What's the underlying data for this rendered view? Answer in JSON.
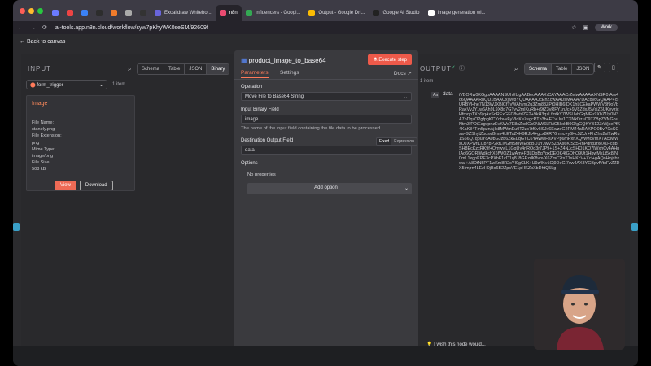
{
  "browser": {
    "tabs": [
      {
        "label": "",
        "color": "#6b7bff"
      },
      {
        "label": "",
        "color": "#e44"
      },
      {
        "label": "",
        "color": "#3b82f6"
      },
      {
        "label": "",
        "color": "#2d2d2d"
      },
      {
        "label": "",
        "color": "#f07b2b"
      },
      {
        "label": "",
        "color": "#aaa"
      },
      {
        "label": "",
        "color": "#333"
      },
      {
        "label": "Excalidraw Whitebo...",
        "color": "#6965db"
      },
      {
        "label": "n8n",
        "color": "#ea4b71"
      },
      {
        "label": "Influencers - Googl...",
        "color": "#34a853"
      },
      {
        "label": "Output - Google Dri...",
        "color": "#fbbc04"
      },
      {
        "label": "Google AI Studio",
        "color": "#222"
      },
      {
        "label": "Image generation wi...",
        "color": "#fff"
      }
    ],
    "url": "ai-tools.app.n8n.cloud/workflow/syw7pKhyWK0seSM/92609f",
    "profile": "Work"
  },
  "app": {
    "back": "Back to canvas",
    "input": {
      "title": "INPUT",
      "views": [
        "Schema",
        "Table",
        "JSON",
        "Binary"
      ],
      "active_view": "Binary",
      "trigger": "form_trigger",
      "items": "1 item",
      "card": {
        "title": "Image",
        "file_name_label": "File Name:",
        "file_name": "stanely.png",
        "ext_label": "File Extension:",
        "ext": "png",
        "mime_label": "Mime Type:",
        "mime": "image/png",
        "size_label": "File Size:",
        "size": "508 kB",
        "view": "View",
        "download": "Download"
      }
    },
    "node": {
      "title": "product_image_to_base64",
      "execute": "Execute step",
      "tabs": [
        "Parameters",
        "Settings"
      ],
      "docs": "Docs",
      "operation_label": "Operation",
      "operation": "Move File to Base64 String",
      "binary_label": "Input Binary Field",
      "binary": "image",
      "binary_hint": "The name of the input field containing the file data to be processed",
      "dest_label": "Destination Output Field",
      "fixed": "Fixed",
      "expression": "Expression",
      "dest": "data",
      "options_label": "Options",
      "no_props": "No properties",
      "add_option": "Add option"
    },
    "output": {
      "title": "OUTPUT",
      "views": [
        "Schema",
        "Table",
        "JSON"
      ],
      "active_view": "Schema",
      "items": "1 item",
      "field": "data",
      "value": "iVBORw0KGgoAAAANSUhEUgAABeoAAAXrCAYAAACrZeiwAAAAAXNSR0IArs4c6QAAAARnQU1BAACxjwv8YQUAAAAJcEhZcwAADsMAAA7DAcdvqGQAAP+lSURBVHhe7N13WJXBlCfTvWAhyrn2u3Zm88ZPt0HIB6IDK1hLCEkaPWWV3f9oVbRaxVvJY1w6Ah9L9X8p7GTyy2mlKuRb+r9tZ3vRFY1nJc+9V8ZdxJ5VcjZ6UKeyzjcHfmqnTXp9jqAxSdRExGFC8wtdZE2+9kH3qzLfmfkY7WSUvbGqMEu9XhZ1ly0N3A7bDqzO2gfpgKCYdbvvFyVIdKeZsgcPTh3b4ETvUw1CXNkDzuC9TZBpZVNGpuNtm3fPDiEagvpnzEvKWs7E8xZxsIGc0NiW6LR/iC5kxkB0O/gGQKYB12ZrWjcePfK4KaK84Tm5pznAjIc8MWmEu0T2zc7tf6vkI9Jx6EwzeG2PM44aRAXPO0BvPXcSCsa+9ZShytZbqsvGnm4LETaZ4H9RJk4+gcx8kR76mhc+y6Hc5ZUr+FhZhu2sf2wRu1S66Q7qpuYcA0bGJzb6ZkELqGYC6YAWwHsXVPp6mPxnXQWMcVmX7Ac3wWsOJXPwrlLCb7bP2ktLIvGmSf8WEobBD1YJwVSZbAs6KtSx5RnPdnpzfxeXu+cdbSH8EcKzcRK9f+QmwyjL1GgUy4nROd3r7JP9+1S+Z4NJcSHQ1KQ7lWxhCv4AHpIAq6GORiWdkchX6fWOZ1wAm+P3LDpBgYpxDEQK4fGOhQ9Ut1HbwMkLt5x8/N0mL1xgpKPE3cPXhF1cD1q8J8GEzdK8vhvX6ZmC2tsT1sHKcV+Xcl+gAQoHojsbxwaI+A8DtN5PF1wKm8R2sYI0gCLK+U9z4Kv1Cj9DeGi7cw4AX8YGBpvfVtxFvZZDX5fmjrn4LEzH0jBo6B2ZpsVE1pHKZbXbDhtQ5Lg"
    },
    "note": "I wish this node would..."
  }
}
